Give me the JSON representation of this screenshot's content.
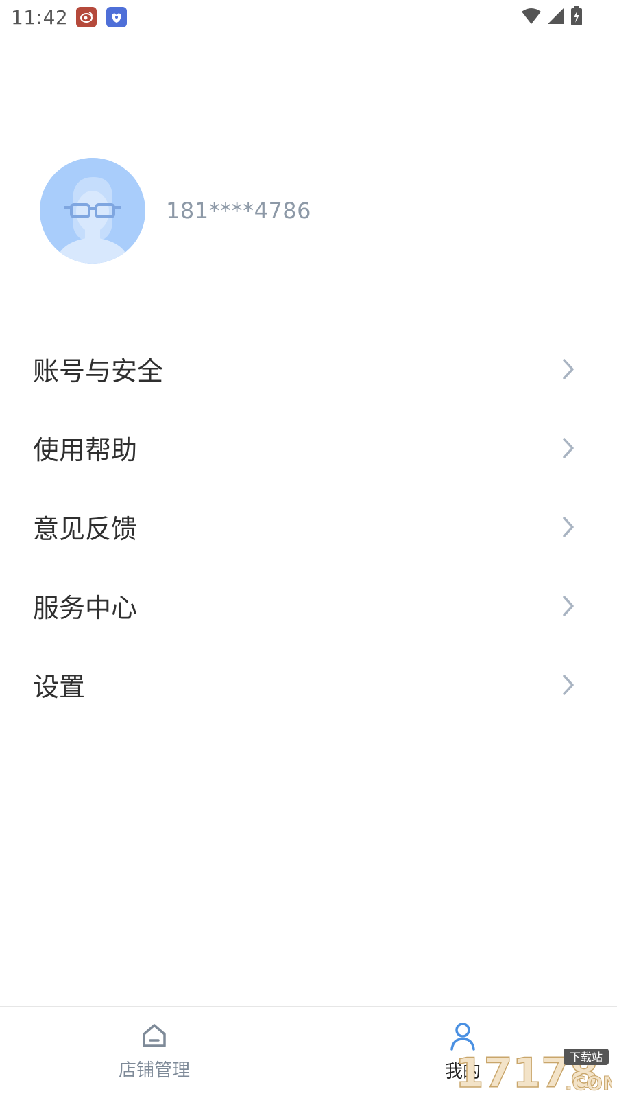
{
  "status_bar": {
    "time": "11:42",
    "notifications": [
      "weibo-icon",
      "bird-app-icon"
    ],
    "system_icons": [
      "wifi-icon",
      "signal-icon",
      "battery-charging-icon"
    ]
  },
  "profile": {
    "phone": "181****4786"
  },
  "menu": {
    "items": [
      {
        "label": "账号与安全"
      },
      {
        "label": "使用帮助"
      },
      {
        "label": "意见反馈"
      },
      {
        "label": "服务中心"
      },
      {
        "label": "设置"
      }
    ]
  },
  "bottom_nav": {
    "items": [
      {
        "label": "店铺管理",
        "icon": "home-icon",
        "active": false
      },
      {
        "label": "我的",
        "icon": "person-icon",
        "active": true
      }
    ]
  },
  "watermark": {
    "text": "17178",
    "sub": "下载站",
    "suffix": ".COM"
  },
  "colors": {
    "accent": "#4a90e2",
    "avatar_bg": "#a9cdfb",
    "secondary_text": "#8d99a7",
    "chevron": "#a9b4c2"
  }
}
